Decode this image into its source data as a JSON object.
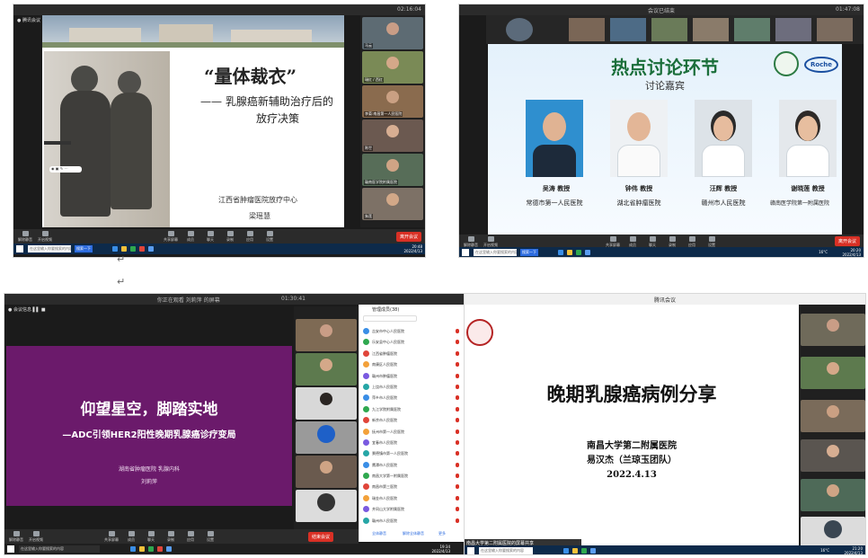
{
  "layout_marks": {
    "enter1": "↵",
    "enter2": "↵"
  },
  "shot1": {
    "top_right": "02:16:04",
    "side_names": [
      "马云",
      "瑞红 / 西红",
      "李菊:南昌第一人民医院",
      "陈世",
      "赣南医学院附属医院",
      "朱莲"
    ],
    "slide": {
      "title": "“量体裁衣”",
      "subtitle_line1": "—— 乳腺癌新辅助治疗后的",
      "subtitle_line2": "放疗决策",
      "org": "江西省肿瘤医院放疗中心",
      "speaker": "梁瑶慧"
    },
    "controls": [
      "解除静音",
      "开启视频",
      "共享屏幕",
      "成员",
      "聊天",
      "录制",
      "应用",
      "设置"
    ],
    "end_label": "离开会议",
    "taskbar_search": "在这里输入你要搜索的内容",
    "taskbar_btn": "搜索一下",
    "time": "20:48",
    "date": "2022/4/13"
  },
  "shot2": {
    "top_title": "会议已结束",
    "top_right": "01:47:08",
    "slide": {
      "title": "热点讨论环节",
      "subtitle": "讨论嘉宾",
      "roche": "Roche",
      "guests": [
        {
          "name": "吴涛 教授",
          "org": "常德市第一人民医院"
        },
        {
          "name": "钟伟 教授",
          "org": "湖北省肿瘤医院"
        },
        {
          "name": "汪辉 教授",
          "org": "赣州市人民医院"
        },
        {
          "name": "谢晓莲 教授",
          "org": "赣南医学院第一附属医院"
        }
      ]
    },
    "controls": [
      "解除静音",
      "开启视频",
      "共享屏幕",
      "成员",
      "聊天",
      "录制",
      "应用",
      "设置"
    ],
    "end_label": "离开会议",
    "taskbar_search": "在这里输入你要搜索的内容",
    "taskbar_btn": "搜索一下",
    "weather": "16°C",
    "time": "20:20",
    "date": "2022/4/13"
  },
  "shot3": {
    "top_title": "你正在观看 刘莉萍 的屏幕",
    "top_right": "01:30:41",
    "slide": {
      "title": "仰望星空，脚踏实地",
      "subtitle": "—ADC引领HER2阳性晚期乳腺癌诊疗变局",
      "org": "湖南省肿瘤医院 乳腺内科",
      "speaker": "刘莉萍"
    },
    "member_panel_title": "管理成员(38)",
    "members": [
      "吉安市中心人民医院",
      "乐安县中心人民医院",
      "江西省肿瘤医院",
      "南康区人民医院",
      "赣州市肿瘤医院",
      "上饶市人民医院",
      "萍乡市人民医院",
      "九江学院附属医院",
      "新余市人民医院",
      "抚州市第一人民医院",
      "宜春市人民医院",
      "景德镇市第一人民医院",
      "鹰潭市人民医院",
      "南昌大学第一附属医院",
      "南昌市第三医院",
      "瑞金市人民医院",
      "井冈山大学附属医院",
      "赣州市人民医院"
    ],
    "panel_buttons": [
      "全体静音",
      "解除全体静音",
      "更多"
    ],
    "controls": [
      "解除静音",
      "开启视频",
      "共享屏幕",
      "成员",
      "聊天",
      "录制",
      "应用",
      "设置"
    ],
    "end_label": "结束会议",
    "taskbar_search": "在这里输入你要搜索的内容",
    "time": "19:34",
    "date": "2022/4/13"
  },
  "shot4": {
    "top_title": "腾讯会议",
    "slide": {
      "title": "晚期乳腺癌病例分享",
      "org": "南昌大学第二附属医院",
      "speaker": "易汉杰（兰琼玉团队）",
      "date": "2022.4.13"
    },
    "bottom_bar": "南昌大学第二附属医院的屏幕共享",
    "taskbar_search": "在这里输入你要搜索的内容",
    "weather": "16°C",
    "time": "21:20",
    "date": "2022/4/13"
  },
  "colors": {
    "purple": "#6b1a6b",
    "green_title": "#1a6e3a",
    "red": "#d93025",
    "taskbar": "#0d2a4a"
  }
}
